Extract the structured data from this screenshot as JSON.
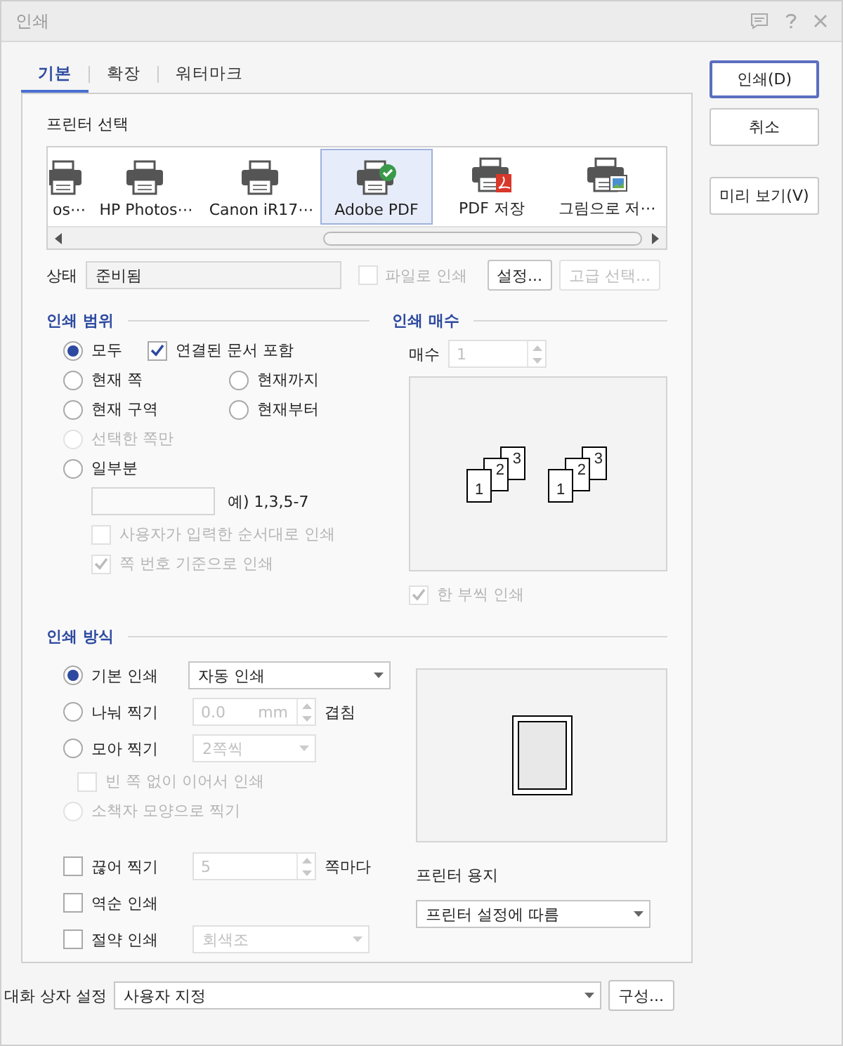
{
  "window": {
    "title": "인쇄"
  },
  "tabs": [
    {
      "label": "기본",
      "selected": true
    },
    {
      "label": "확장",
      "selected": false
    },
    {
      "label": "워터마크",
      "selected": false
    }
  ],
  "side_buttons": [
    {
      "label": "인쇄(D)",
      "default": true
    },
    {
      "label": "취소",
      "default": false
    },
    {
      "label": "미리 보기(V)",
      "default": false
    }
  ],
  "printer_select": {
    "title": "프린터 선택",
    "printers": [
      {
        "label": "os⋯",
        "kind": "printer",
        "selected": false,
        "cut": true
      },
      {
        "label": "HP Photos⋯",
        "kind": "printer",
        "selected": false,
        "cut": false
      },
      {
        "label": "Canon iR17⋯",
        "kind": "printer",
        "selected": false,
        "cut": false
      },
      {
        "label": "Adobe PDF",
        "kind": "default",
        "selected": true,
        "cut": false
      },
      {
        "label": "PDF 저장",
        "kind": "pdf",
        "selected": false,
        "cut": false
      },
      {
        "label": "그림으로 저⋯",
        "kind": "image",
        "selected": false,
        "cut": false
      }
    ],
    "status_label": "상태",
    "status": "준비됨",
    "print_to_file": {
      "label": "파일로 인쇄",
      "checked": false,
      "disabled": true
    },
    "buttons": [
      {
        "label": "설정...",
        "disabled": false
      },
      {
        "label": "고급 선택...",
        "disabled": true
      }
    ]
  },
  "range": {
    "title": "인쇄 범위",
    "all": {
      "label": "모두",
      "selected": true
    },
    "linked": {
      "label": "연결된 문서 포함",
      "checked": true,
      "disabled": false
    },
    "options": [
      {
        "label": "현재 쪽",
        "selected": false
      },
      {
        "label": "현재까지",
        "selected": false
      },
      {
        "label": "현재 구역",
        "selected": false
      },
      {
        "label": "현재부터",
        "selected": false
      }
    ],
    "selected_only": {
      "label": "선택한 쪽만",
      "selected": false,
      "disabled": true
    },
    "partial": {
      "label": "일부분",
      "selected": false
    },
    "example": "예) 1,3,5-7",
    "checks": [
      {
        "label": "사용자가 입력한 순서대로 인쇄",
        "checked": false,
        "disabled": true
      },
      {
        "label": "쪽 번호 기준으로 인쇄",
        "checked": true,
        "disabled": true
      }
    ]
  },
  "copies": {
    "title": "인쇄 매수",
    "label": "매수",
    "value": "1",
    "disabled": true,
    "sets": [
      [
        "1",
        "2",
        "3"
      ],
      [
        "1",
        "2",
        "3"
      ]
    ],
    "collate": {
      "label": "한 부씩 인쇄",
      "checked": true,
      "disabled": true
    }
  },
  "method": {
    "title": "인쇄 방식",
    "modes": [
      {
        "label": "기본 인쇄",
        "selected": true,
        "control": {
          "kind": "select",
          "value": "자동 인쇄",
          "disabled": false
        }
      },
      {
        "label": "나눠 찍기",
        "selected": false,
        "control": {
          "kind": "spin",
          "value": "0.0",
          "unit": "mm",
          "disabled": true
        },
        "suffix": "겹침"
      },
      {
        "label": "모아 찍기",
        "selected": false,
        "control": {
          "kind": "select",
          "value": "2쪽씩",
          "disabled": true
        }
      }
    ],
    "continuous": {
      "label": "빈 쪽 없이 이어서 인쇄",
      "checked": false,
      "disabled": true
    },
    "booklet": {
      "label": "소책자 모양으로 찍기",
      "selected": false,
      "disabled": true
    },
    "options": [
      {
        "label": "끊어 찍기",
        "checked": false,
        "control": {
          "kind": "spin",
          "value": "5",
          "disabled": true
        },
        "suffix": "쪽마다"
      },
      {
        "label": "역순 인쇄",
        "checked": false
      },
      {
        "label": "절약 인쇄",
        "checked": false,
        "control": {
          "kind": "select",
          "value": "회색조",
          "disabled": true
        }
      }
    ],
    "paper_label": "프린터 용지",
    "paper": "프린터 설정에 따름"
  },
  "footer": {
    "label": "대화 상자 설정",
    "value": "사용자 지정",
    "button": "구성..."
  }
}
